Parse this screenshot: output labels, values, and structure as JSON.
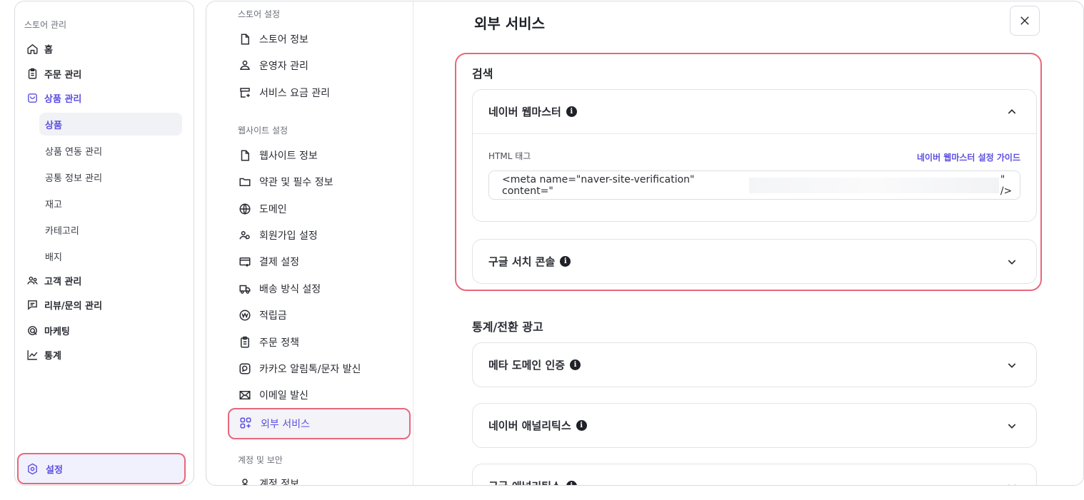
{
  "sidebar": {
    "section_label": "스토어 관리",
    "items": [
      {
        "label": "홈",
        "icon": "home-icon"
      },
      {
        "label": "주문 관리",
        "icon": "clipboard-icon"
      },
      {
        "label": "상품 관리",
        "icon": "bag-icon"
      },
      {
        "label": "고객 관리",
        "icon": "users-icon"
      },
      {
        "label": "리뷰/문의 관리",
        "icon": "message-icon"
      },
      {
        "label": "마케팅",
        "icon": "target-icon"
      },
      {
        "label": "통계",
        "icon": "chart-line-icon"
      }
    ],
    "product_subitems": [
      "상품",
      "상품 연동 관리",
      "공통 정보 관리",
      "재고",
      "카테고리",
      "배지"
    ],
    "settings_label": "설정"
  },
  "settings_nav": {
    "store_section": "스토어 설정",
    "store_items": [
      "스토어 정보",
      "운영자 관리",
      "서비스 요금 관리"
    ],
    "website_section": "웹사이트 설정",
    "website_items": [
      "웹사이트 정보",
      "약관 및 필수 정보",
      "도메인",
      "회원가입 설정",
      "결제 설정",
      "배송 방식 설정",
      "적립금",
      "주문 정책",
      "카카오 알림톡/문자 발신",
      "이메일 발신",
      "외부 서비스"
    ],
    "account_section": "계정 및 보안",
    "account_items": [
      "계정 정보"
    ]
  },
  "content": {
    "title": "외부 서비스",
    "search_group": "검색",
    "naver_webmaster": {
      "title": "네이버 웹마스터",
      "field_label": "HTML 태그",
      "guide_link": "네이버 웹마스터 설정 가이드",
      "meta_prefix": "<meta name=\"naver-site-verification\" content=\"",
      "meta_suffix": "\" />"
    },
    "google_search_console": "구글 서치 콘솔",
    "stats_group": "통계/전환 광고",
    "meta_domain": "메타 도메인 인증",
    "naver_analytics": "네이버 애널리틱스",
    "google_analytics": "구글 애널리틱스"
  },
  "colors": {
    "accent": "#5b4fe0",
    "highlight": "#e8677b"
  }
}
